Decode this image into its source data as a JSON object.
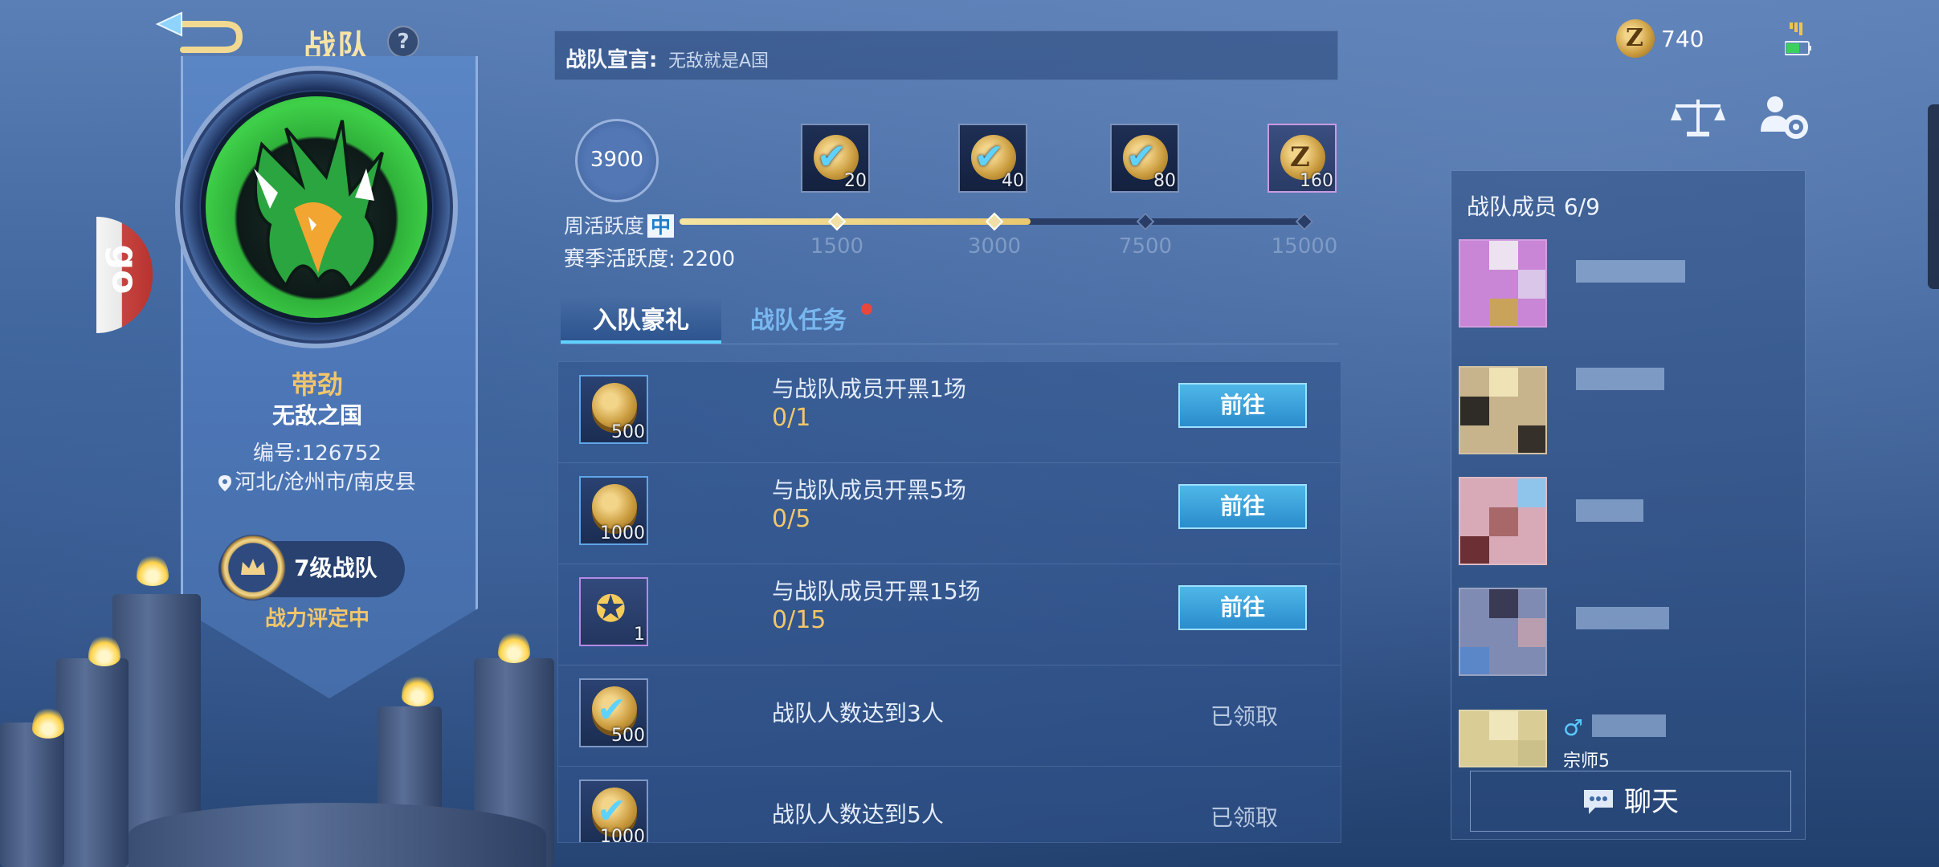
{
  "header": {
    "title": "战队",
    "help_symbol": "?"
  },
  "side_badge": {
    "text": "go"
  },
  "team": {
    "tag": "带劲",
    "name": "无敌之国",
    "id_text": "编号:126752",
    "location": "河北/沧州市/南皮县",
    "level": "7级战队",
    "power_status": "战力评定中"
  },
  "declaration": {
    "label": "战队宣言:",
    "value": "无敌就是A国"
  },
  "activity": {
    "score": "3900",
    "weekly_label": "周活跃度",
    "weekly_level": "中",
    "season_label": "赛季活跃度: 2200",
    "weekly_progress_fraction": 0.56,
    "milestones": [
      {
        "threshold": "1500",
        "reward_qty": "20",
        "claimed": true,
        "icon": "check-icon"
      },
      {
        "threshold": "3000",
        "reward_qty": "40",
        "claimed": true,
        "icon": "check-icon"
      },
      {
        "threshold": "7500",
        "reward_qty": "80",
        "claimed": true,
        "icon": "check-icon"
      },
      {
        "threshold": "15000",
        "reward_qty": "160",
        "claimed": false,
        "icon": "z-coin-icon"
      }
    ]
  },
  "tabs": [
    {
      "label": "入队豪礼",
      "active": true
    },
    {
      "label": "战队任务",
      "active": false,
      "has_dot": true
    }
  ],
  "tasks": [
    {
      "title": "与战队成员开黑1场",
      "progress": "0/1",
      "reward_qty": "500",
      "icon": "coin-icon",
      "action": "前往"
    },
    {
      "title": "与战队成员开黑5场",
      "progress": "0/5",
      "reward_qty": "1000",
      "icon": "coin-icon",
      "action": "前往"
    },
    {
      "title": "与战队成员开黑15场",
      "progress": "0/15",
      "reward_qty": "1",
      "icon": "star-badge-icon",
      "action": "前往"
    },
    {
      "title": "战队人数达到3人",
      "progress": "",
      "reward_qty": "500",
      "icon": "check-icon",
      "action": "已领取"
    },
    {
      "title": "战队人数达到5人",
      "progress": "",
      "reward_qty": "1000",
      "icon": "check-icon",
      "action": "已领取"
    }
  ],
  "currency": {
    "amount": "740",
    "icon": "z-coin-icon",
    "symbol": "Z"
  },
  "members": {
    "title": "战队成员 6/9",
    "last_member_sub": "宗师5",
    "chat_label": "聊天"
  },
  "colors": {
    "accent_gold": "#f2c66a",
    "accent_blue": "#5fd1ff",
    "button_blue": "#2a8ccc",
    "notification_red": "#e8473b"
  }
}
